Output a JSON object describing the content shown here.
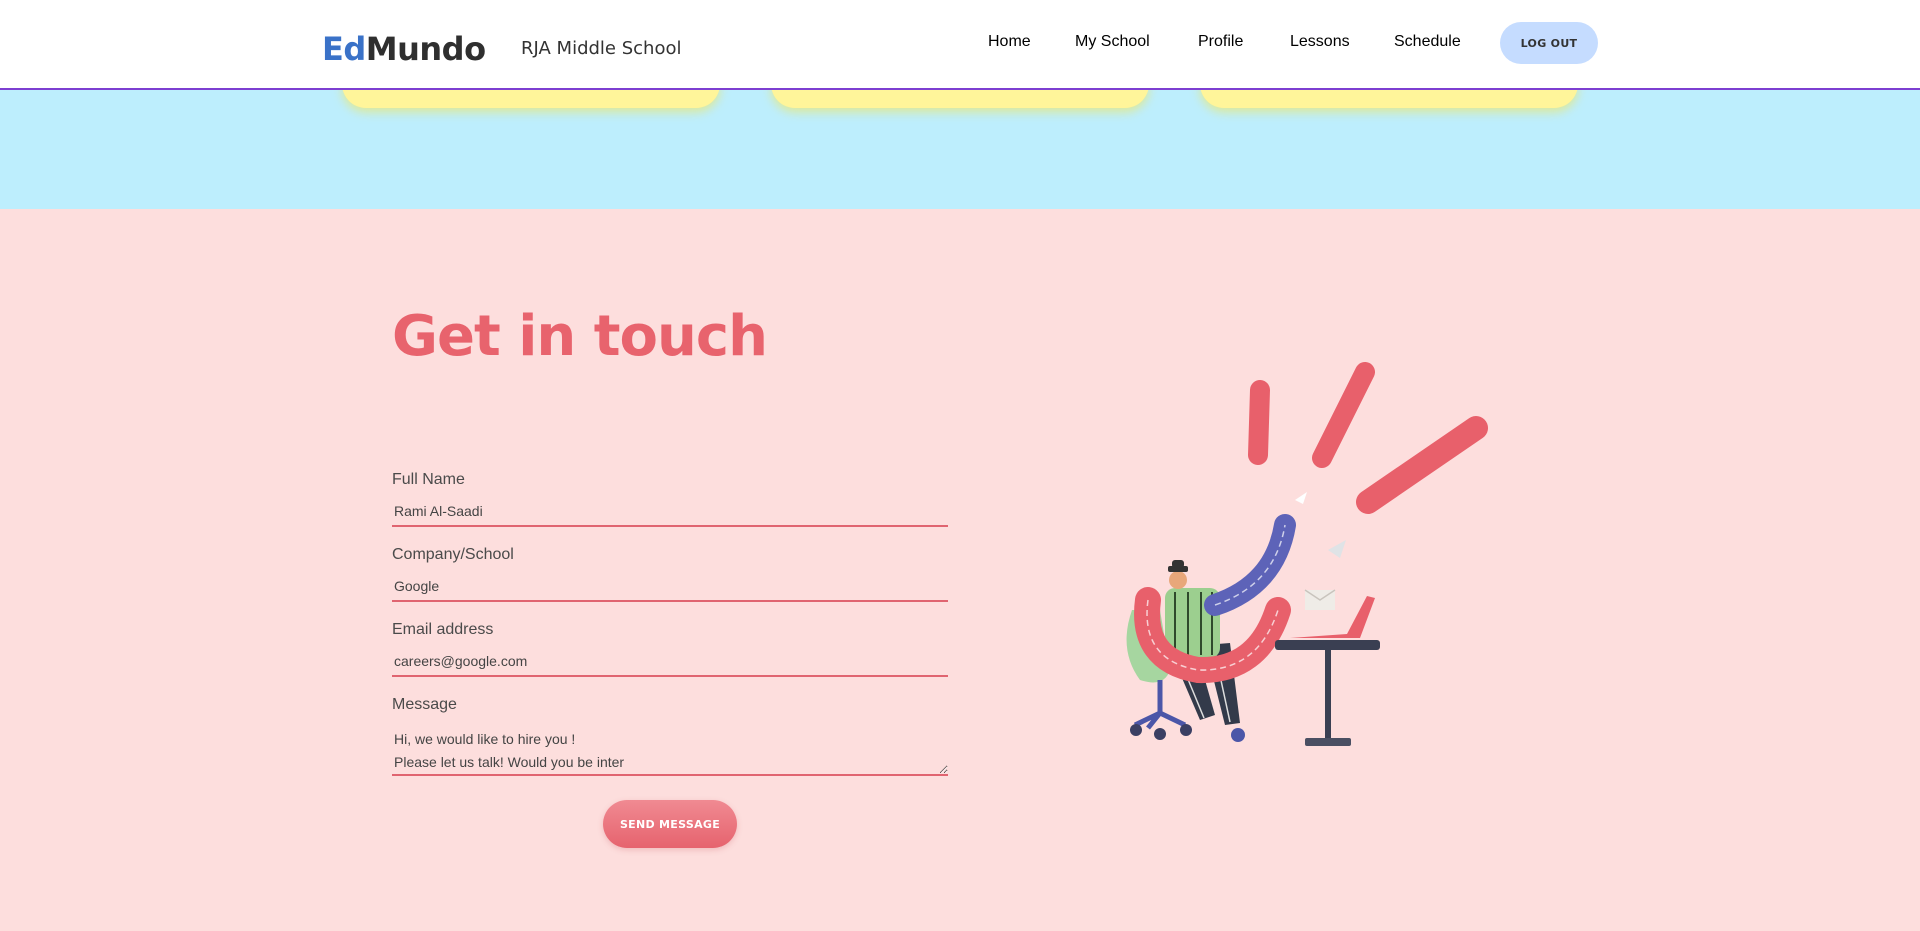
{
  "header": {
    "logo_part1": "Ed",
    "logo_part2": "Mundo",
    "school": "RJA Middle School",
    "nav": [
      "Home",
      "My School",
      "Profile",
      "Lessons",
      "Schedule"
    ],
    "active_nav": "Home",
    "logout_label": "LOG OUT"
  },
  "contact": {
    "title": "Get in touch",
    "fields": [
      {
        "label": "Full Name",
        "value": "Rami Al-Saadi"
      },
      {
        "label": "Company/School",
        "value": "Google"
      },
      {
        "label": "Email address",
        "value": "careers@google.com"
      }
    ],
    "message": {
      "label": "Message",
      "value": "Hi, we would like to hire you !\nPlease let us talk! Would you be inter"
    },
    "send_label": "SEND MESSAGE"
  },
  "colors": {
    "accent": "#e8636d",
    "brand_blue": "#3a72c8",
    "page_bg": "#fddedd",
    "band_bg": "#bdeefd"
  }
}
